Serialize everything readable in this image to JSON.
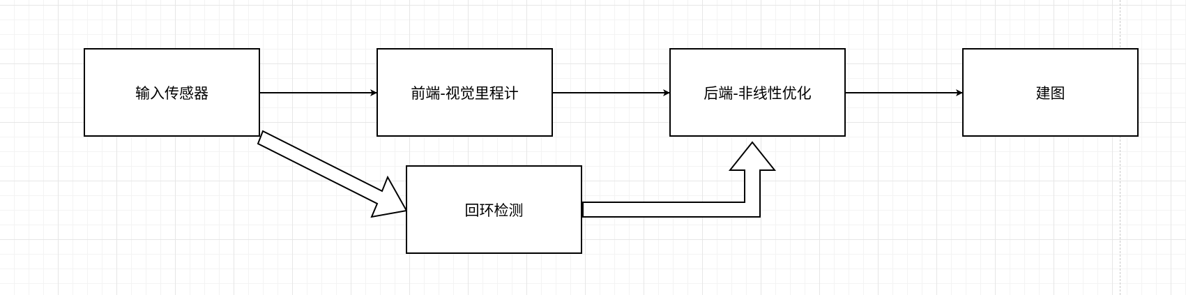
{
  "nodes": {
    "input_sensor": "输入传感器",
    "frontend_vo": "前端-视觉里程计",
    "backend_opt": "后端-非线性优化",
    "mapping": "建图",
    "loop_closure": "回环检测"
  },
  "colors": {
    "stroke": "#000000",
    "fill": "#ffffff",
    "grid_major": "#e6e6e6",
    "grid_minor": "#f3f3f3"
  }
}
